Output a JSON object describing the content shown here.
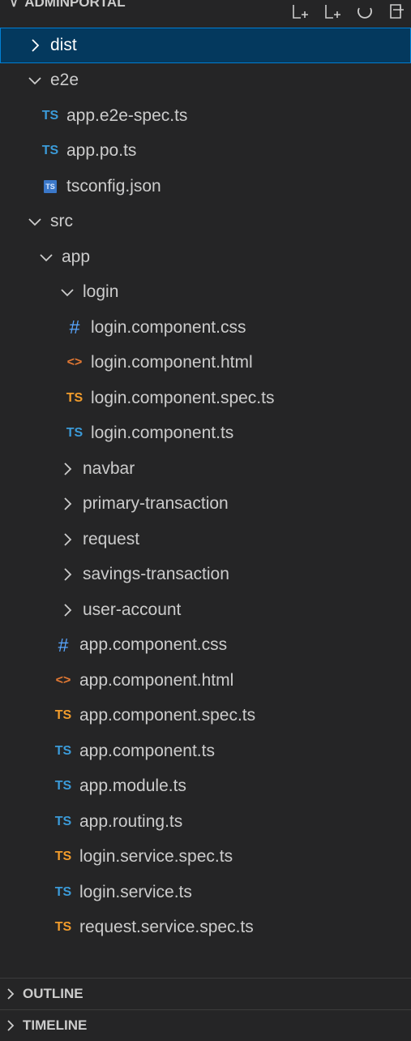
{
  "explorer": {
    "title": "ADMINPORTAL",
    "actions": [
      "new-file-icon",
      "new-folder-icon",
      "refresh-icon",
      "collapse-all-icon"
    ]
  },
  "tree": [
    {
      "label": "dist",
      "type": "folder",
      "expanded": false,
      "depth": 0,
      "selected": true
    },
    {
      "label": "e2e",
      "type": "folder",
      "expanded": true,
      "depth": 0
    },
    {
      "label": "app.e2e-spec.ts",
      "type": "ts",
      "depth": 1
    },
    {
      "label": "app.po.ts",
      "type": "ts",
      "depth": 1
    },
    {
      "label": "tsconfig.json",
      "type": "json",
      "depth": 1
    },
    {
      "label": "src",
      "type": "folder",
      "expanded": true,
      "depth": 0
    },
    {
      "label": "app",
      "type": "folder",
      "expanded": true,
      "depth": 1
    },
    {
      "label": "login",
      "type": "folder",
      "expanded": true,
      "depth": 2
    },
    {
      "label": "login.component.css",
      "type": "css",
      "depth": 3
    },
    {
      "label": "login.component.html",
      "type": "html",
      "depth": 3
    },
    {
      "label": "login.component.spec.ts",
      "type": "tsspec",
      "depth": 3
    },
    {
      "label": "login.component.ts",
      "type": "ts",
      "depth": 3
    },
    {
      "label": "navbar",
      "type": "folder",
      "expanded": false,
      "depth": 2
    },
    {
      "label": "primary-transaction",
      "type": "folder",
      "expanded": false,
      "depth": 2
    },
    {
      "label": "request",
      "type": "folder",
      "expanded": false,
      "depth": 2
    },
    {
      "label": "savings-transaction",
      "type": "folder",
      "expanded": false,
      "depth": 2
    },
    {
      "label": "user-account",
      "type": "folder",
      "expanded": false,
      "depth": 2
    },
    {
      "label": "app.component.css",
      "type": "css",
      "depth": 2
    },
    {
      "label": "app.component.html",
      "type": "html",
      "depth": 2
    },
    {
      "label": "app.component.spec.ts",
      "type": "tsspec",
      "depth": 2
    },
    {
      "label": "app.component.ts",
      "type": "ts",
      "depth": 2
    },
    {
      "label": "app.module.ts",
      "type": "ts",
      "depth": 2
    },
    {
      "label": "app.routing.ts",
      "type": "ts",
      "depth": 2
    },
    {
      "label": "login.service.spec.ts",
      "type": "tsspec",
      "depth": 2
    },
    {
      "label": "login.service.ts",
      "type": "ts",
      "depth": 2
    },
    {
      "label": "request.service.spec.ts",
      "type": "tsspec",
      "depth": 2
    }
  ],
  "icons": {
    "ts": {
      "glyph": "TS",
      "name": "typescript-icon"
    },
    "tsspec": {
      "glyph": "TS",
      "name": "typescript-test-icon"
    },
    "css": {
      "glyph": "#",
      "name": "css-icon"
    },
    "html": {
      "glyph": "<>",
      "name": "html-icon"
    },
    "json": {
      "glyph": "TS",
      "name": "tsconfig-icon"
    }
  },
  "colors": {
    "background": "#252526",
    "selected": "#04395e",
    "ts": "#3b9bd9",
    "tsspec": "#f19c2c",
    "html": "#e37933",
    "css": "#58a6ff"
  },
  "sections": {
    "outline": "OUTLINE",
    "timeline": "TIMELINE"
  }
}
